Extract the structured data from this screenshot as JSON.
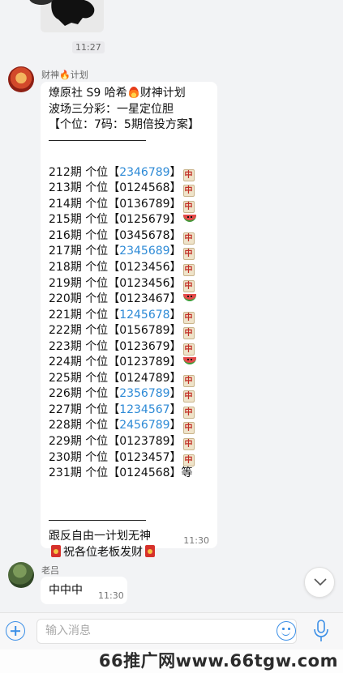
{
  "chat": {
    "prev_time": "11:27",
    "messages": [
      {
        "sender": "财神🔥计划",
        "lines": [
          {
            "text": "燎原社 S9 哈希",
            "icon_after": "fire-icon",
            "text2": "财神计划"
          },
          {
            "text": "波场三分彩：一星定位胆"
          },
          {
            "text": "【个位：7码：5期倍投方案】"
          },
          {
            "separator": true
          },
          {
            "blank": true
          },
          {
            "issue": "212期",
            "pos": "个位",
            "code": "2346789",
            "hl": true,
            "result": "中"
          },
          {
            "issue": "213期",
            "pos": "个位",
            "code": "0124568",
            "hl": false,
            "result": "中"
          },
          {
            "issue": "214期",
            "pos": "个位",
            "code": "0136789",
            "hl": false,
            "result": "中"
          },
          {
            "issue": "215期",
            "pos": "个位",
            "code": "0125679",
            "hl": false,
            "result": "watermelon"
          },
          {
            "issue": "216期",
            "pos": "个位",
            "code": "0345678",
            "hl": false,
            "result": "中"
          },
          {
            "issue": "217期",
            "pos": "个位",
            "code": "2345689",
            "hl": true,
            "result": "中"
          },
          {
            "issue": "218期",
            "pos": "个位",
            "code": "0123456",
            "hl": false,
            "result": "中"
          },
          {
            "issue": "219期",
            "pos": "个位",
            "code": "0123456",
            "hl": false,
            "result": "中"
          },
          {
            "issue": "220期",
            "pos": "个位",
            "code": "0123467",
            "hl": false,
            "result": "watermelon"
          },
          {
            "issue": "221期",
            "pos": "个位",
            "code": "1245678",
            "hl": true,
            "result": "中"
          },
          {
            "issue": "222期",
            "pos": "个位",
            "code": "0156789",
            "hl": false,
            "result": "中"
          },
          {
            "issue": "223期",
            "pos": "个位",
            "code": "0123679",
            "hl": false,
            "result": "中"
          },
          {
            "issue": "224期",
            "pos": "个位",
            "code": "0123789",
            "hl": false,
            "result": "watermelon"
          },
          {
            "issue": "225期",
            "pos": "个位",
            "code": "0124789",
            "hl": false,
            "result": "中"
          },
          {
            "issue": "226期",
            "pos": "个位",
            "code": "2356789",
            "hl": true,
            "result": "中"
          },
          {
            "issue": "227期",
            "pos": "个位",
            "code": "1234567",
            "hl": true,
            "result": "中"
          },
          {
            "issue": "228期",
            "pos": "个位",
            "code": "2456789",
            "hl": true,
            "result": "中"
          },
          {
            "issue": "229期",
            "pos": "个位",
            "code": "0123789",
            "hl": false,
            "result": "中"
          },
          {
            "issue": "230期",
            "pos": "个位",
            "code": "0123457",
            "hl": false,
            "result": "中"
          },
          {
            "issue": "231期",
            "pos": "个位",
            "code": "0124568",
            "hl": false,
            "result_text": "等"
          },
          {
            "blank": true
          },
          {
            "blank": true
          },
          {
            "separator": true
          },
          {
            "text": "跟反自由一计划无神"
          },
          {
            "wish": "祝各位老板发财"
          }
        ],
        "time": "11:30"
      },
      {
        "sender": "老吕",
        "text": "中中中",
        "time": "11:30"
      }
    ]
  },
  "input": {
    "placeholder": "输入消息"
  },
  "watermark": "66推广网www.66tgw.com",
  "colors": {
    "accent": "#3a8ee6",
    "highlight_code": "#2d8ad6",
    "tile_text": "#c23028"
  }
}
